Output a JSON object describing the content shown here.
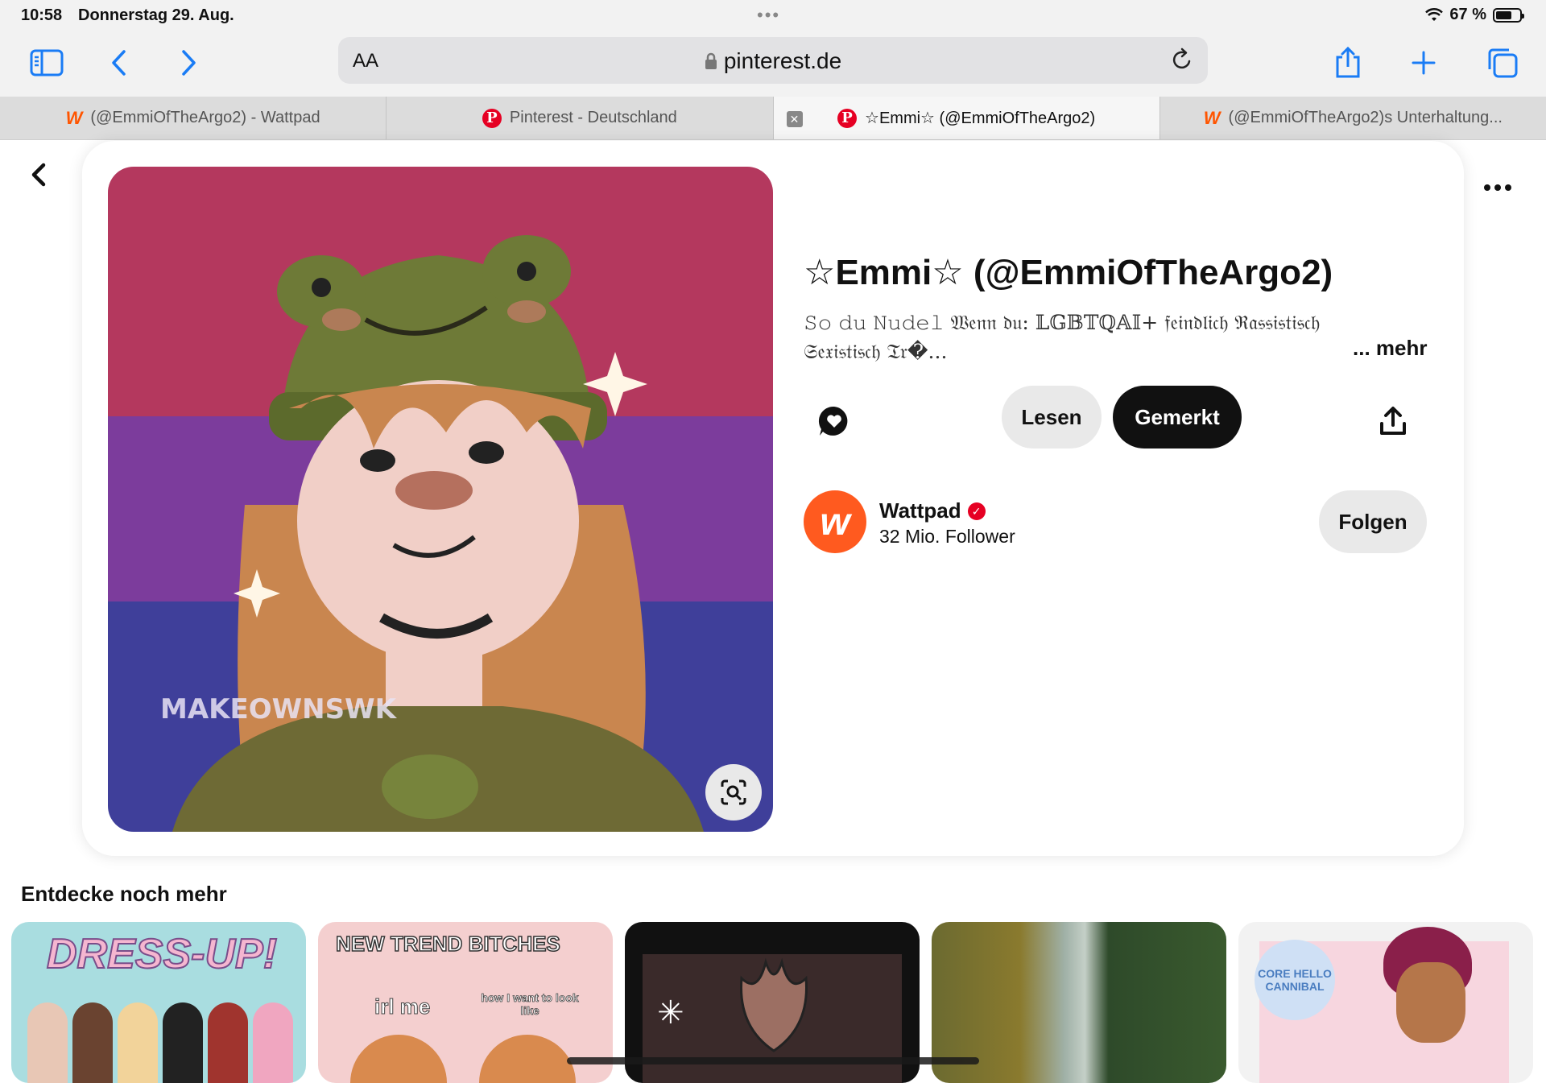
{
  "status_bar": {
    "time": "10:58",
    "date": "Donnerstag 29. Aug.",
    "battery": "67 %",
    "battery_level": 0.67
  },
  "toolbar": {
    "text_size_label": "AA",
    "url": "pinterest.de"
  },
  "tabs": [
    {
      "title": "(@EmmiOfTheArgo2) - Wattpad",
      "site_icon": "wattpad-logo",
      "active": false
    },
    {
      "title": "Pinterest - Deutschland",
      "site_icon": "pinterest-logo",
      "active": false
    },
    {
      "title": "☆Emmi☆ (@EmmiOfTheArgo2)",
      "site_icon": "pinterest-logo",
      "active": true
    },
    {
      "title": "(@EmmiOfTheArgo2)s Unterhaltung...",
      "site_icon": "wattpad-logo",
      "active": false
    }
  ],
  "pin": {
    "title": "☆Emmi☆ (@EmmiOfTheArgo2)",
    "description": "𝚂𝚘 𝚍𝚞 𝙽𝚞𝚍𝚎𝚕 𝔚𝔢𝔫𝔫 𝔡𝔲: 𝕃𝔾𝔹𝕋ℚ𝔸𝕀+ 𝔣𝔢𝔦𝔫𝔡𝔩𝔦𝔠𝔥 ℜ𝔞𝔰𝔰𝔦𝔰𝔱𝔦𝔰𝔠𝔥 𝔖𝔢𝔵𝔦𝔰𝔱𝔦𝔰𝔠𝔥 𝔗𝔯�...",
    "more_label": "... mehr",
    "image_watermark": "MAKEOWNSWK"
  },
  "actions": {
    "read_label": "Lesen",
    "saved_label": "Gemerkt"
  },
  "creator": {
    "name": "Wattpad",
    "followers": "32 Mio. Follower",
    "follow_label": "Folgen"
  },
  "explore": {
    "title": "Entdecke noch mehr",
    "thumbnails": [
      {
        "text": "DRESS-UP!"
      },
      {
        "text": "NEW TREND BITCHES",
        "left_text": "irl me",
        "right_text": "how I want to look like"
      },
      {
        "text": ""
      },
      {
        "text": ""
      },
      {
        "text": "CORE HELLO CANNIBAL"
      }
    ]
  },
  "colors": {
    "pinterest_red": "#e60023",
    "wattpad_orange": "#ff5500",
    "saved_button": "#111111",
    "secondary_button": "#e9e9e9"
  }
}
